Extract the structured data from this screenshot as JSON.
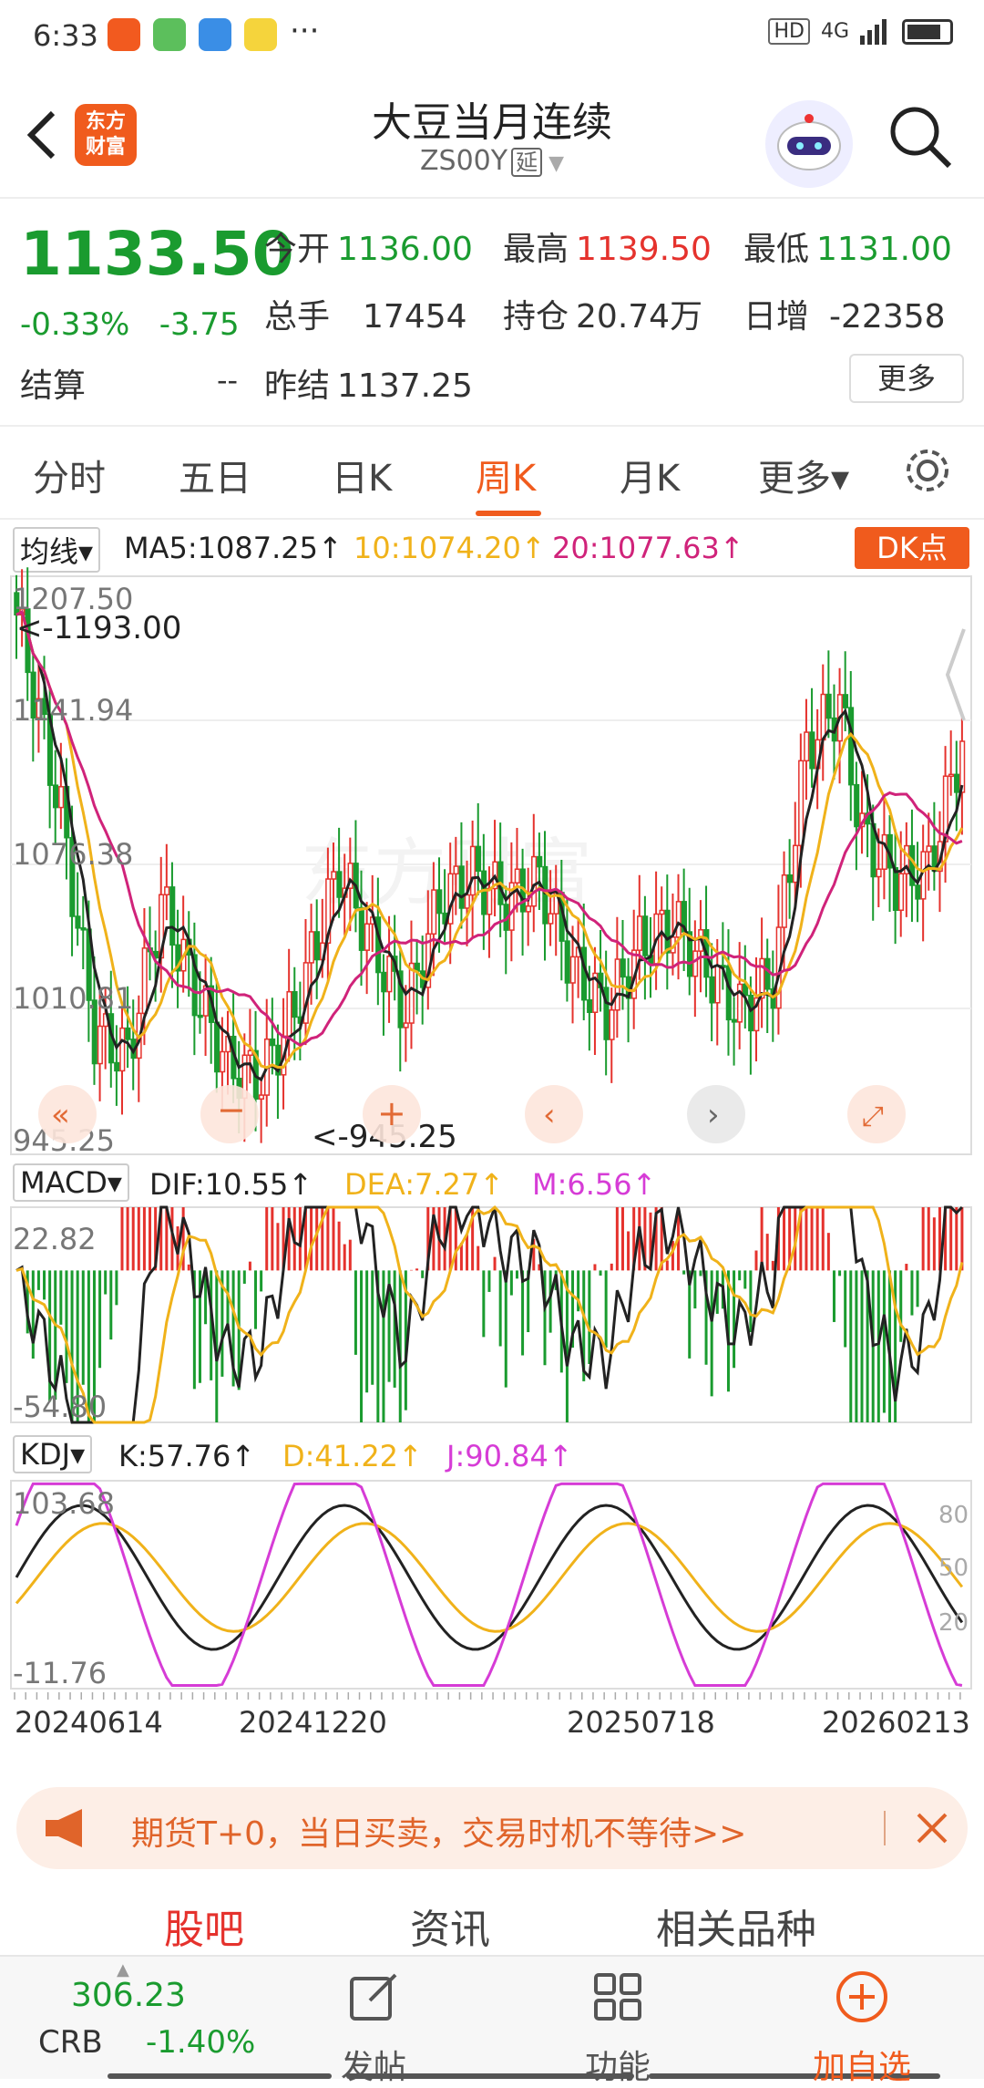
{
  "status_bar": {
    "time": "6:33",
    "dots": "···",
    "hd": "HD",
    "net": "4G"
  },
  "header": {
    "title": "大豆当月连续",
    "code": "ZS00Y",
    "tag": "延",
    "logo_line1": "东方",
    "logo_line2": "财富"
  },
  "quote": {
    "price": "1133.50",
    "change_pct": "-0.33%",
    "change": "-3.75",
    "settle_label": "结算",
    "settle_value": "--",
    "open_label": "今开",
    "open": "1136.00",
    "high_label": "最高",
    "high": "1139.50",
    "low_label": "最低",
    "low": "1131.00",
    "volume_label": "总手",
    "volume": "17454",
    "oi_label": "持仓",
    "oi": "20.74万",
    "daily_inc_label": "日增",
    "daily_inc": "-22358",
    "prev_settle_label": "昨结",
    "prev_settle": "1137.25",
    "more": "更多"
  },
  "tabs": [
    "分时",
    "五日",
    "日K",
    "周K",
    "月K",
    "更多▾"
  ],
  "active_tab": "周K",
  "ma": {
    "selector": "均线▾",
    "ma5": "MA5:1087.25↑",
    "ma10": "10:1074.20↑",
    "ma20": "20:1077.63↑",
    "dk": "DK点"
  },
  "kline": {
    "y_labels": [
      "1207.50",
      "1141.94",
      "1076.38",
      "1010.81",
      "945.25"
    ],
    "max_label": "<-1193.00",
    "min_label": "<-945.25",
    "watermark": "东方财富"
  },
  "macd": {
    "selector": "MACD▾",
    "dif": "DIF:10.55↑",
    "dea": "DEA:7.27↑",
    "m": "M:6.56↑",
    "top": "22.82",
    "bottom": "-54.80"
  },
  "kdj": {
    "selector": "KDJ▾",
    "k": "K:57.76↑",
    "d": "D:41.22↑",
    "j": "J:90.84↑",
    "top": "103.68",
    "bottom": "-11.76",
    "l80": "80",
    "l50": "50",
    "l20": "20"
  },
  "dates": [
    "20240614",
    "20241220",
    "20250718",
    "20260213"
  ],
  "promo": {
    "text": "期货T+0，当日买卖，交易时机不等待>>"
  },
  "section_tabs": [
    "股吧",
    "资讯",
    "相关品种"
  ],
  "bottom_bar": {
    "crb_value": "306.23",
    "crb_name": "CRB",
    "crb_change": "-1.40%",
    "items": [
      "发帖",
      "功能",
      "加自选"
    ]
  },
  "colors": {
    "accent": "#f05b1d",
    "up": "#e5322d",
    "down": "#1a9b2f",
    "ma10": "#f0b21a",
    "ma20": "#d0237a"
  },
  "chart_data": {
    "type": "candlestick",
    "ylim": [
      945.25,
      1207.5
    ],
    "title": "大豆当月连续 周K",
    "ma": {
      "MA5": 1087.25,
      "MA10": 1074.2,
      "MA20": 1077.63
    },
    "macd": {
      "DIF": 10.55,
      "DEA": 7.27,
      "M": 6.56
    },
    "kdj": {
      "K": 57.76,
      "D": 41.22,
      "J": 90.84
    }
  }
}
